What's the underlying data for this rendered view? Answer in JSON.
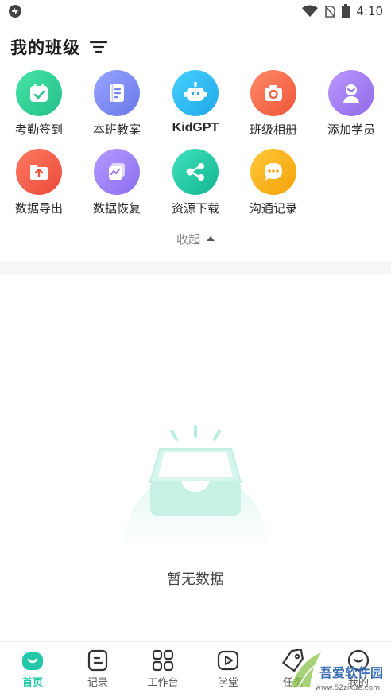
{
  "status_bar": {
    "time": "4:10",
    "icons": [
      "app-icon",
      "wifi-icon",
      "no-sim-icon",
      "battery-icon"
    ]
  },
  "header": {
    "title": "我的班级",
    "filter_icon": "filter-icon"
  },
  "grid": {
    "items": [
      {
        "label": "考勤签到",
        "icon": "attendance-icon",
        "color": "#2fcf93"
      },
      {
        "label": "本班教案",
        "icon": "lesson-plan-icon",
        "color": "#7b8cf5"
      },
      {
        "label": "KidGPT",
        "icon": "robot-icon",
        "color": "#2db8f0"
      },
      {
        "label": "班级相册",
        "icon": "camera-icon",
        "color": "#f26a4f"
      },
      {
        "label": "添加学员",
        "icon": "add-student-icon",
        "color": "#a07ef0"
      },
      {
        "label": "数据导出",
        "icon": "data-export-icon",
        "color": "#f25a48"
      },
      {
        "label": "数据恢复",
        "icon": "data-restore-icon",
        "color": "#9a7ff2"
      },
      {
        "label": "资源下载",
        "icon": "share-icon",
        "color": "#25c9a5"
      },
      {
        "label": "沟通记录",
        "icon": "chat-icon",
        "color": "#f7b21d"
      }
    ],
    "collapse_label": "收起"
  },
  "empty_state": {
    "text": "暂无数据"
  },
  "tabbar": {
    "tabs": [
      {
        "label": "首页",
        "icon": "home-icon",
        "active": true
      },
      {
        "label": "记录",
        "icon": "record-icon",
        "active": false
      },
      {
        "label": "工作台",
        "icon": "workbench-icon",
        "active": false
      },
      {
        "label": "学堂",
        "icon": "video-icon",
        "active": false
      },
      {
        "label": "任务",
        "icon": "tag-icon",
        "active": false
      },
      {
        "label": "我的",
        "icon": "profile-icon",
        "active": false
      }
    ]
  },
  "watermark": {
    "text": "吾爱软件园",
    "url": "www.52zixue.com"
  },
  "colors": {
    "accent": "#22c8a8"
  }
}
